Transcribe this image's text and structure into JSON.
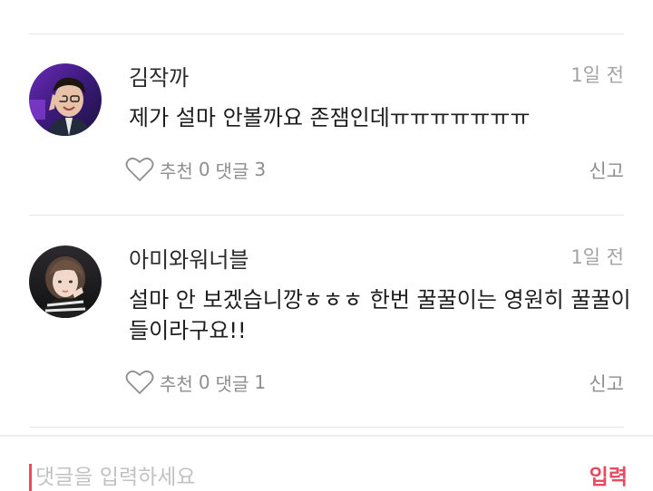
{
  "comments": [
    {
      "author": "김작까",
      "time": "1일 전",
      "text": "제가 설마 안볼까요 존잼인데ㅠㅠㅠㅠㅠㅠㅠ",
      "like_label": "추천",
      "like_count": "0",
      "reply_label": "댓글",
      "reply_count": "3",
      "report_label": "신고",
      "avatar_icon": "avatar-photo"
    },
    {
      "author": "아미와워너블",
      "time": "1일 전",
      "text": "설마 안 보겠습니깡ㅎㅎㅎ 한번 꿀꿀이는 영원히 꿀꿀이들이라구요!!",
      "like_label": "추천",
      "like_count": "0",
      "reply_label": "댓글",
      "reply_count": "1",
      "report_label": "신고",
      "avatar_icon": "avatar-photo"
    }
  ],
  "input": {
    "placeholder": "댓글을 입력하세요",
    "value": "",
    "submit_label": "입력"
  },
  "colors": {
    "accent": "#e84a5f",
    "muted": "#8e8e8e",
    "divider": "#e4e4e4"
  }
}
